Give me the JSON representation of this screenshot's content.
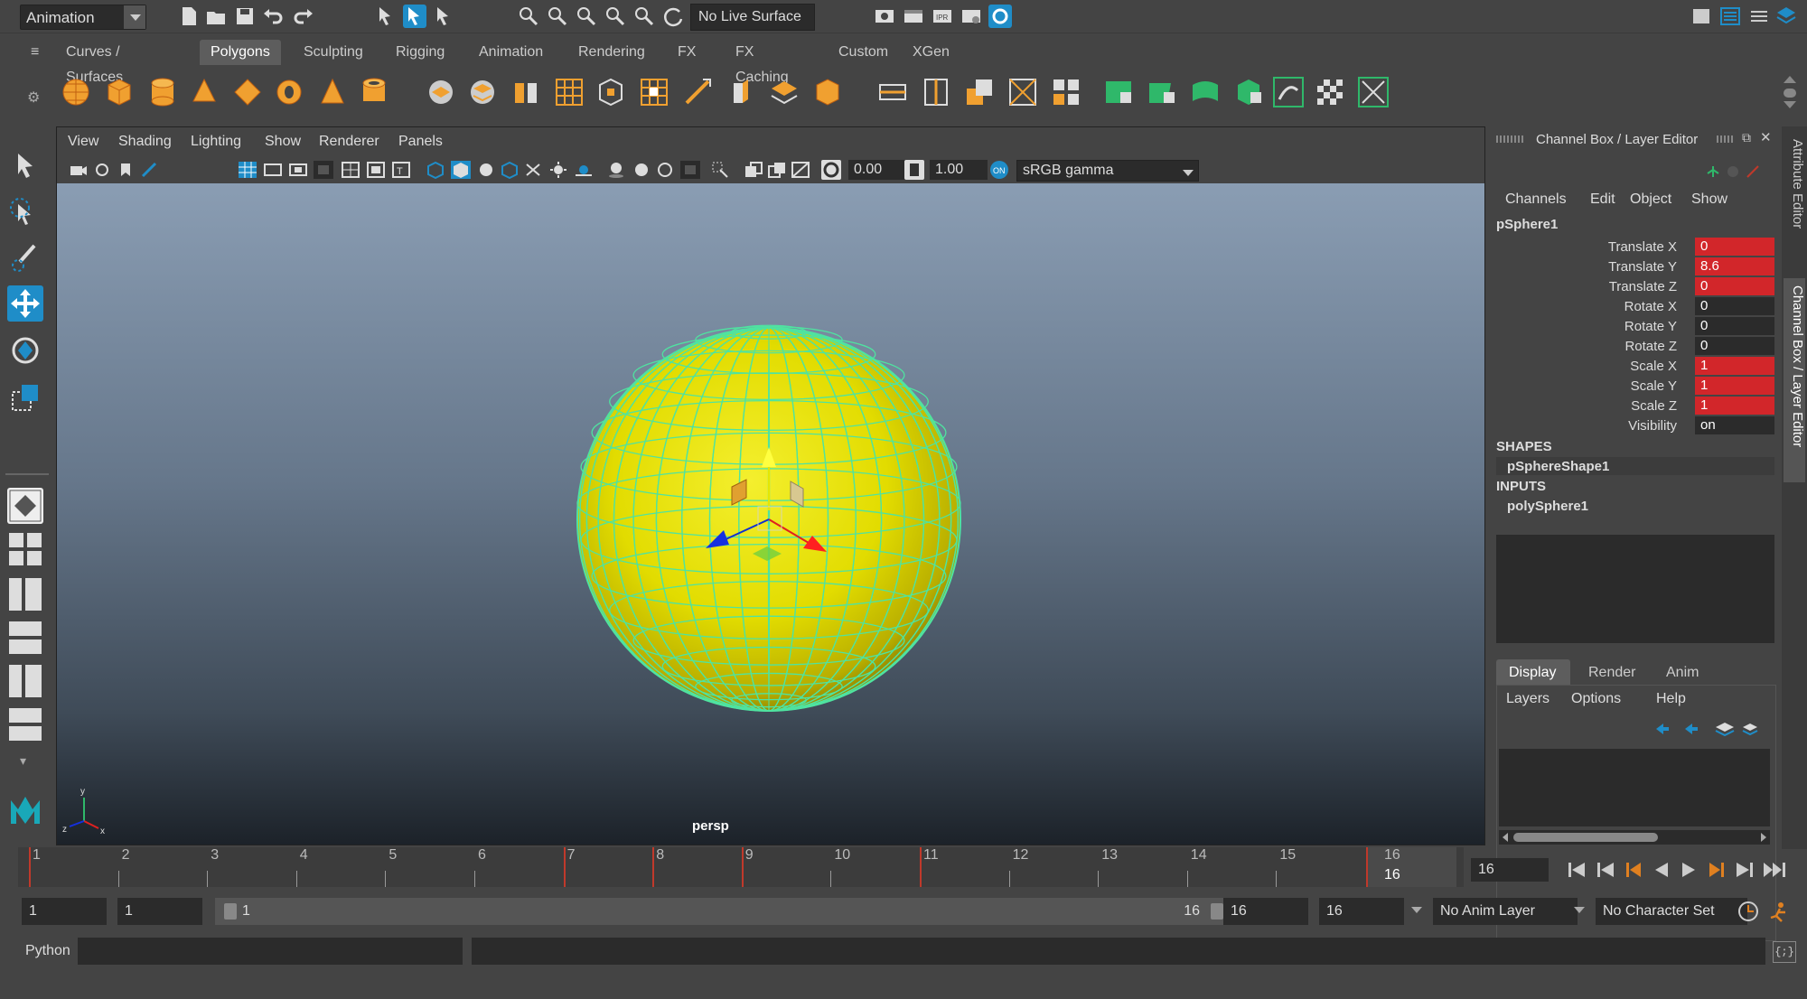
{
  "status_line": {
    "mode": "Animation",
    "live_surface": "No Live Surface"
  },
  "shelf_tabs": [
    "Curves / Surfaces",
    "Polygons",
    "Sculpting",
    "Rigging",
    "Animation",
    "Rendering",
    "FX",
    "FX Caching",
    "Custom",
    "XGen"
  ],
  "active_shelf_tab": "Polygons",
  "viewport": {
    "menu": [
      "View",
      "Shading",
      "Lighting",
      "Show",
      "Renderer",
      "Panels"
    ],
    "exposure": "0.00",
    "gamma": "1.00",
    "color_space": "sRGB gamma",
    "camera_label": "persp"
  },
  "channel_box": {
    "title": "Channel Box / Layer Editor",
    "menu": [
      "Channels",
      "Edit",
      "Object",
      "Show"
    ],
    "object": "pSphere1",
    "channels": [
      {
        "label": "Translate X",
        "value": "0",
        "keyed": true
      },
      {
        "label": "Translate Y",
        "value": "8.6",
        "keyed": true
      },
      {
        "label": "Translate Z",
        "value": "0",
        "keyed": true
      },
      {
        "label": "Rotate X",
        "value": "0",
        "keyed": false
      },
      {
        "label": "Rotate Y",
        "value": "0",
        "keyed": false
      },
      {
        "label": "Rotate Z",
        "value": "0",
        "keyed": false
      },
      {
        "label": "Scale X",
        "value": "1",
        "keyed": true
      },
      {
        "label": "Scale Y",
        "value": "1",
        "keyed": true
      },
      {
        "label": "Scale Z",
        "value": "1",
        "keyed": true
      },
      {
        "label": "Visibility",
        "value": "on",
        "keyed": false
      }
    ],
    "shapes_header": "SHAPES",
    "shape": "pSphereShape1",
    "inputs_header": "INPUTS",
    "input": "polySphere1"
  },
  "layer_editor": {
    "tabs": [
      "Display",
      "Render",
      "Anim"
    ],
    "active_tab": "Display",
    "menu": [
      "Layers",
      "Options",
      "Help"
    ]
  },
  "side_tabs": [
    "Attribute Editor",
    "Channel Box / Layer Editor"
  ],
  "timeline": {
    "frames": [
      "1",
      "2",
      "3",
      "4",
      "5",
      "6",
      "7",
      "8",
      "9",
      "10",
      "11",
      "12",
      "13",
      "14",
      "15",
      "16"
    ],
    "current_frame_top": "16",
    "current_frame_bottom": "16",
    "current_frame_field": "16",
    "keyframes": [
      1,
      7,
      8,
      9,
      11,
      16
    ]
  },
  "range": {
    "start": "1",
    "playback_start": "1",
    "slider_start": "1",
    "slider_end": "16",
    "playback_end": "16",
    "end": "16",
    "anim_layer": "No Anim Layer",
    "character_set": "No Character Set"
  },
  "command_line": {
    "language": "Python"
  },
  "colors": {
    "keyed": "#d2262a",
    "wire": "#4fe3a0",
    "sphere": "#e6e000",
    "accent": "#1f8dc8"
  }
}
